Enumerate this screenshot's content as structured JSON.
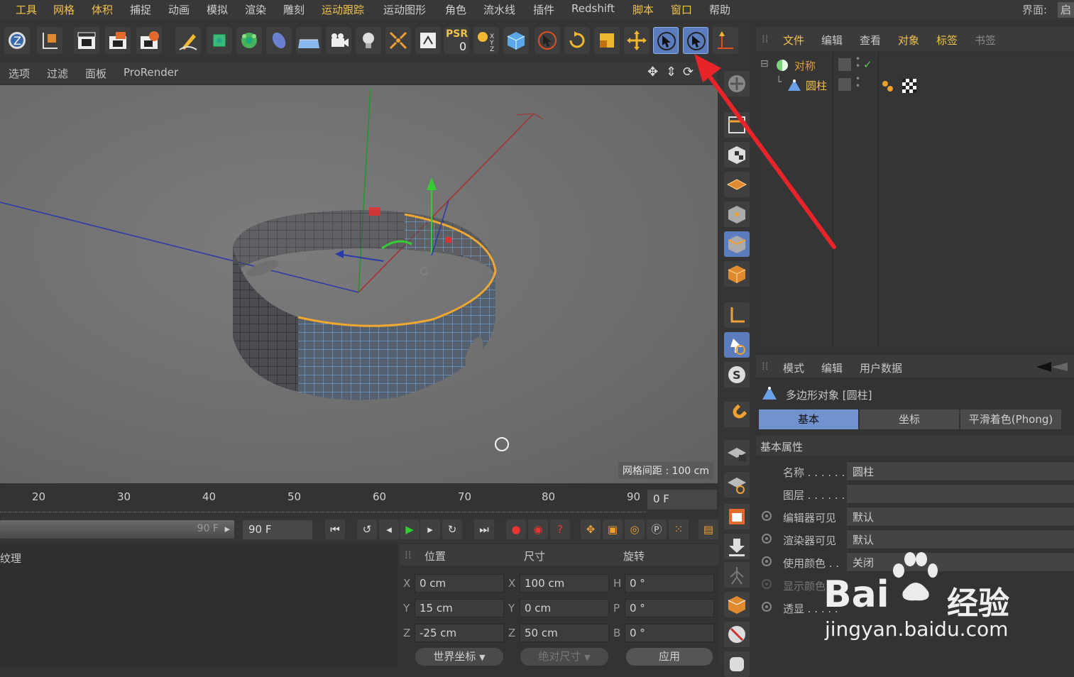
{
  "menubar": {
    "items": [
      {
        "label": "工具",
        "hl": true
      },
      {
        "label": "网格",
        "hl": true
      },
      {
        "label": "体积",
        "hl": true
      },
      {
        "label": "捕捉",
        "hl": false
      },
      {
        "label": "动画",
        "hl": false
      },
      {
        "label": "模拟",
        "hl": false
      },
      {
        "label": "渲染",
        "hl": false
      },
      {
        "label": "雕刻",
        "hl": false
      },
      {
        "label": "运动跟踪",
        "hl": true
      },
      {
        "label": "运动图形",
        "hl": false
      },
      {
        "label": "角色",
        "hl": false
      },
      {
        "label": "流水线",
        "hl": false
      },
      {
        "label": "插件",
        "hl": false
      },
      {
        "label": "Redshift",
        "hl": false
      },
      {
        "label": "脚本",
        "hl": true
      },
      {
        "label": "窗口",
        "hl": true
      },
      {
        "label": "帮助",
        "hl": false
      }
    ],
    "layout_label": "界面:",
    "layout_value": "启"
  },
  "toolbar": {
    "psr_label": "PSR",
    "psr_value": "0"
  },
  "viewport": {
    "menus": [
      "选项",
      "过滤",
      "面板",
      "ProRender"
    ],
    "grid_info": "网格间距 : 100 cm"
  },
  "object_manager": {
    "menus": [
      {
        "label": "文件",
        "style": "hl"
      },
      {
        "label": "编辑",
        "style": "normal"
      },
      {
        "label": "查看",
        "style": "normal"
      },
      {
        "label": "对象",
        "style": "hl"
      },
      {
        "label": "标签",
        "style": "hl"
      },
      {
        "label": "书签",
        "style": "dim"
      }
    ],
    "objects": [
      {
        "name": "对称",
        "color": "#e0a030"
      },
      {
        "name": "圆柱",
        "color": "#f0c24a"
      }
    ]
  },
  "attribute_manager": {
    "menus": [
      "模式",
      "编辑",
      "用户数据"
    ],
    "object_title": "多边形对象 [圆柱]",
    "tabs": [
      "基本",
      "坐标",
      "平滑着色(Phong)"
    ],
    "section": "基本属性",
    "rows": [
      {
        "label": "名称 . . . . . .",
        "value": "圆柱",
        "radio": false
      },
      {
        "label": "图层 . . . . . .",
        "value": "",
        "radio": false
      },
      {
        "label": "编辑器可见",
        "value": "默认",
        "radio": true
      },
      {
        "label": "渲染器可见",
        "value": "默认",
        "radio": true
      },
      {
        "label": "使用颜色 . .",
        "value": "关闭",
        "radio": true
      },
      {
        "label": "显示颜色",
        "value": "",
        "radio": true
      },
      {
        "label": "透显 . . . . .",
        "value": "",
        "radio": true
      }
    ]
  },
  "timeline": {
    "ticks": [
      "20",
      "30",
      "40",
      "50",
      "60",
      "70",
      "80",
      "90"
    ],
    "current_frame": "0 F",
    "end_frame_preview": "90 F",
    "end_frame": "90 F"
  },
  "material_manager": {
    "title": "纹理"
  },
  "coordinates": {
    "headers": [
      "位置",
      "尺寸",
      "旋转"
    ],
    "position": [
      {
        "axis": "X",
        "value": "0 cm"
      },
      {
        "axis": "Y",
        "value": "15 cm"
      },
      {
        "axis": "Z",
        "value": "-25 cm"
      }
    ],
    "size": [
      {
        "axis": "X",
        "value": "100 cm"
      },
      {
        "axis": "Y",
        "value": "0 cm"
      },
      {
        "axis": "Z",
        "value": "50 cm"
      }
    ],
    "rotation": [
      {
        "axis": "H",
        "value": "0 °"
      },
      {
        "axis": "P",
        "value": "0 °"
      },
      {
        "axis": "B",
        "value": "0 °"
      }
    ],
    "world_coord_label": "世界坐标",
    "abs_size_label": "绝对尺寸",
    "apply_label": "应用"
  },
  "watermark": {
    "brand": "Bai",
    "brand_tail": "经验",
    "url": "jingyan.baidu.com"
  },
  "annotation": {
    "arrow_color": "#e8242a"
  }
}
